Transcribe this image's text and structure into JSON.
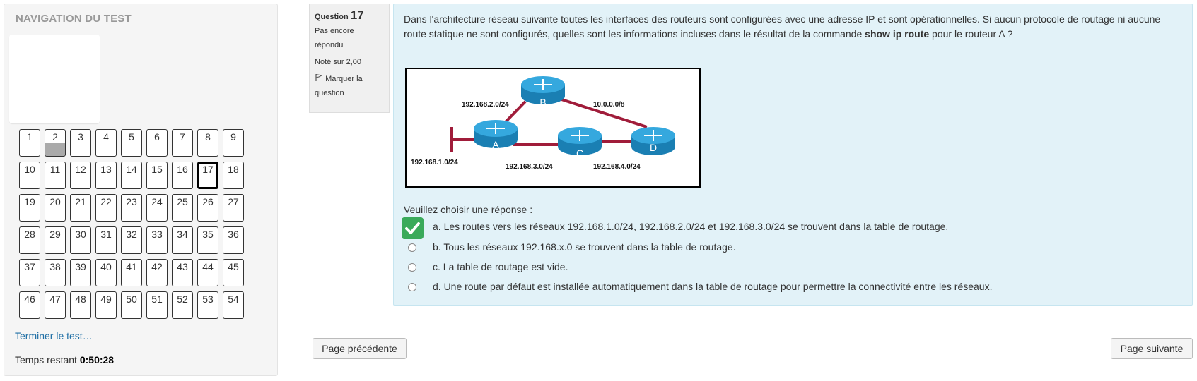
{
  "navigation": {
    "title": "NAVIGATION DU TEST",
    "questions": [
      "1",
      "2",
      "3",
      "4",
      "5",
      "6",
      "7",
      "8",
      "9",
      "10",
      "11",
      "12",
      "13",
      "14",
      "15",
      "16",
      "17",
      "18",
      "19",
      "20",
      "21",
      "22",
      "23",
      "24",
      "25",
      "26",
      "27",
      "28",
      "29",
      "30",
      "31",
      "32",
      "33",
      "34",
      "35",
      "36",
      "37",
      "38",
      "39",
      "40",
      "41",
      "42",
      "43",
      "44",
      "45",
      "46",
      "47",
      "48",
      "49",
      "50",
      "51",
      "52",
      "53",
      "54"
    ],
    "current_question": "17",
    "answered_question": "2",
    "finish_link": "Terminer le test…",
    "time_label": "Temps restant",
    "time_value": "0:50:28"
  },
  "question_info": {
    "label": "Question",
    "number": "17",
    "status_line1": "Pas encore",
    "status_line2": "répondu",
    "grade": "Noté sur 2,00",
    "flag_line1": "Marquer la",
    "flag_line2": "question"
  },
  "question": {
    "text_before": "Dans l'architecture réseau suivante toutes les interfaces des routeurs sont configurées avec une adresse IP et sont opérationnelles. Si aucun protocole de routage ni aucune route statique ne sont configurés, quelles sont les informations incluses dans le résultat de la commande ",
    "command": "show ip route",
    "text_after": " pour le routeur A ?",
    "diagram": {
      "routers": [
        "A",
        "B",
        "C",
        "D"
      ],
      "networks": {
        "ab": "192.168.2.0/24",
        "bd": "10.0.0.0/8",
        "lan_a": "192.168.1.0/24",
        "ac": "192.168.3.0/24",
        "cd": "192.168.4.0/24"
      },
      "link_color": "#a01c3a",
      "router_color": "#1f8fc4"
    },
    "prompt": "Veuillez choisir une réponse :",
    "answers": [
      "a. Les routes vers les réseaux 192.168.1.0/24, 192.168.2.0/24 et 192.168.3.0/24 se trouvent dans la table de routage.",
      "b. Tous les réseaux 192.168.x.0 se trouvent dans la table de routage.",
      "c. La table de routage est vide.",
      "d. Une route par défaut est installée automatiquement dans la table de routage pour permettre la connectivité entre les réseaux."
    ],
    "checked_answer_icon": "checkmark-icon"
  },
  "footer": {
    "prev_label": "Page précédente",
    "next_label": "Page suivante"
  }
}
